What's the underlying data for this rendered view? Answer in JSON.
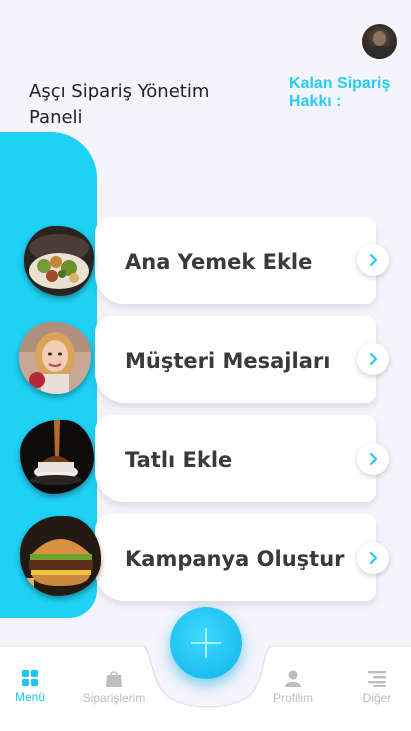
{
  "header": {
    "panel_title": "Aşçı Sipariş Yönetim Paneli",
    "quota_label": "Kalan Sipariş Hakkı :"
  },
  "menu_cards": [
    {
      "label": "Ana Yemek Ekle",
      "image": "main-dish-photo"
    },
    {
      "label": "Müşteri Mesajları",
      "image": "customer-photo"
    },
    {
      "label": "Tatlı Ekle",
      "image": "dessert-photo"
    },
    {
      "label": "Kampanya Oluştur",
      "image": "burger-photo"
    }
  ],
  "bottom_nav": {
    "items": [
      {
        "label": "Menü",
        "icon": "grid-icon",
        "active": true
      },
      {
        "label": "Siparişlerim",
        "icon": "bag-icon",
        "active": false
      },
      {
        "label": "Profilim",
        "icon": "person-icon",
        "active": false
      },
      {
        "label": "Diğer",
        "icon": "list-icon",
        "active": false
      }
    ],
    "fab_icon": "plus-icon"
  },
  "colors": {
    "accent": "#1ed1f5",
    "background": "#f5f4fa",
    "card": "#ffffff",
    "text": "#3a3a3a",
    "inactive": "#bdbdbd"
  }
}
